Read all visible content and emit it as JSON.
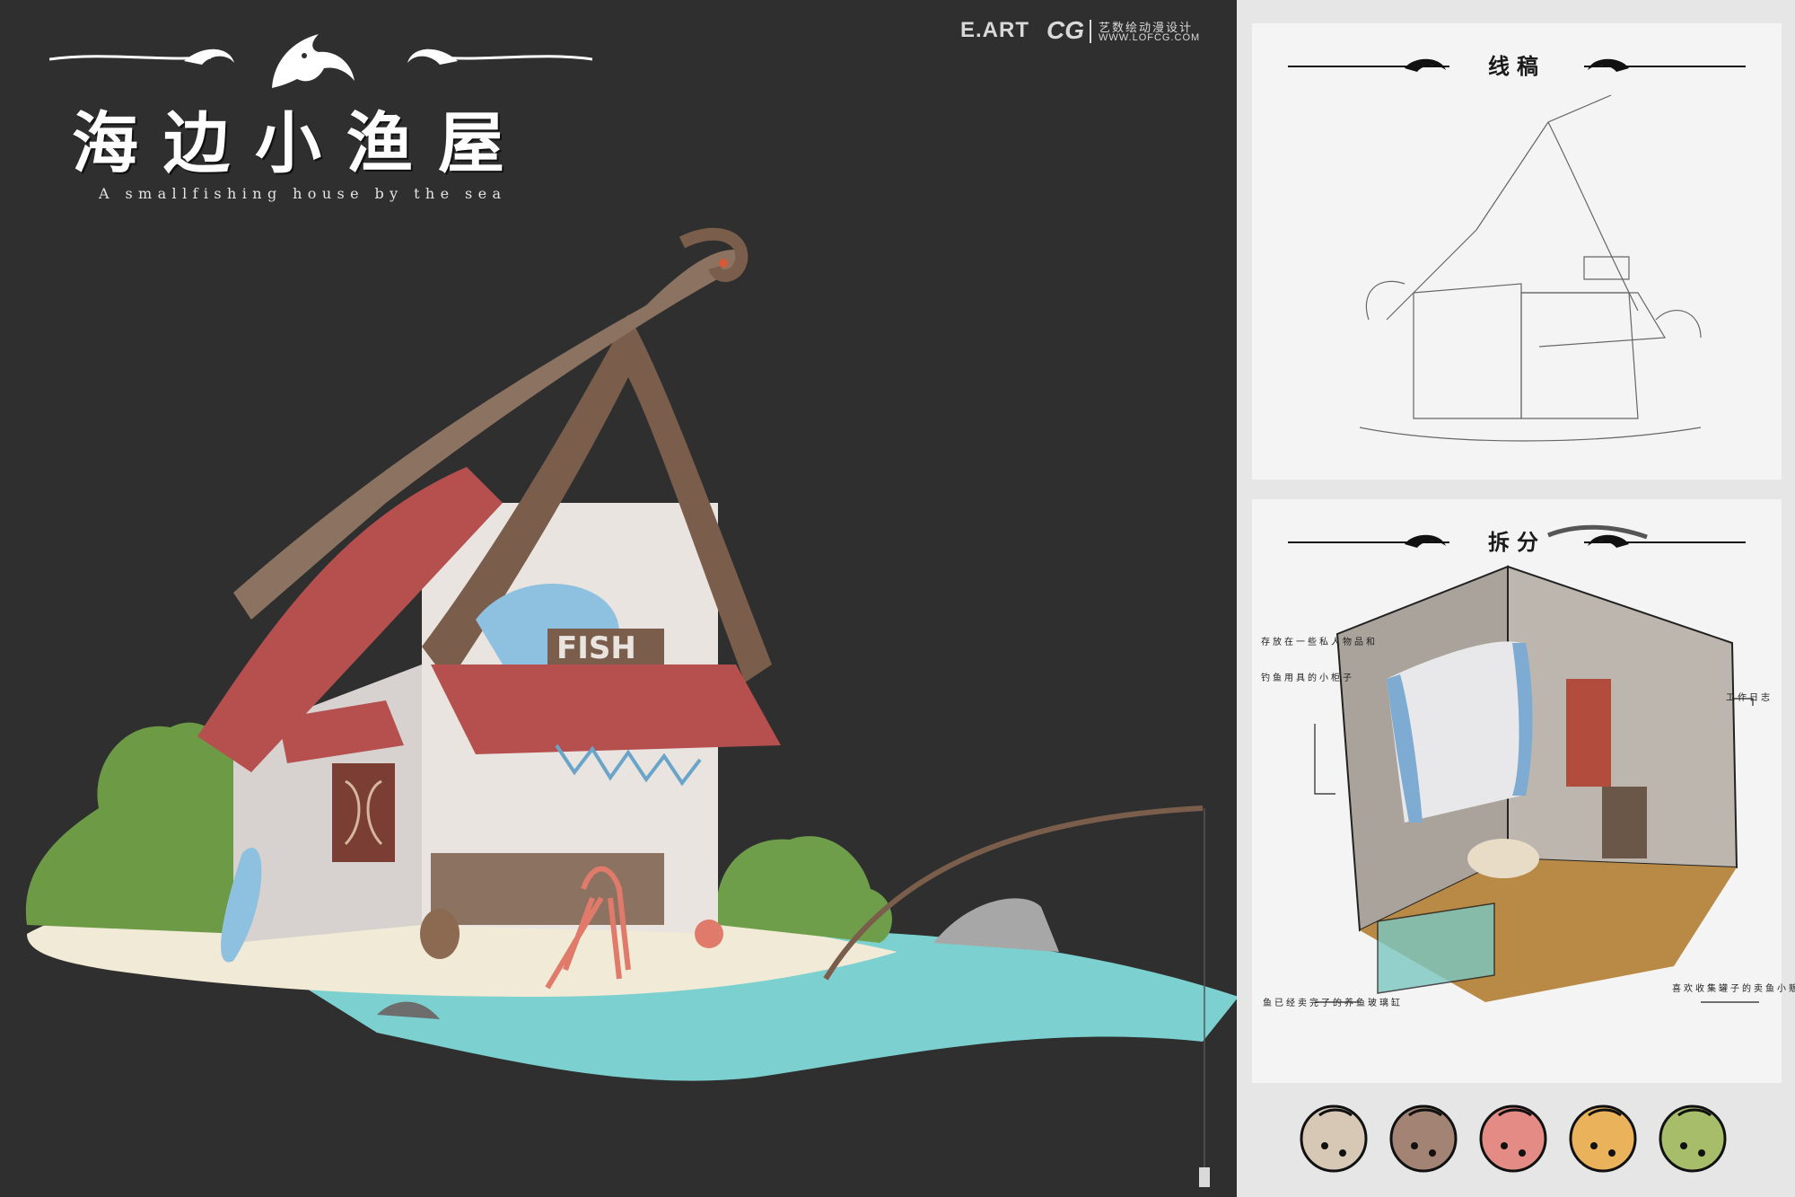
{
  "brand": {
    "logo_text": "E.ART",
    "logo_mark": "CG",
    "name_cn": "艺数绘动漫设计",
    "url": "WWW.LOFCG.COM"
  },
  "title": {
    "main": "海边小渔屋",
    "subtitle": "A smallfishing house by the sea"
  },
  "scene": {
    "sign_text": "FISH"
  },
  "panels": {
    "lineart_title": "线稿",
    "breakdown_title": "拆分",
    "annotations": {
      "cabinet_line1": "存放在一些私人物品和",
      "cabinet_line2": "钓鱼用具的小柜子",
      "work_log": "工作日志",
      "tank": "鱼已经卖完了的养鱼玻璃缸",
      "vendor": "喜欢收集罐子的卖鱼小贩"
    }
  },
  "palette": {
    "background_dark": "#2f2f2f",
    "roof_red": "#b6504f",
    "wood_brown": "#7a5e4b",
    "water_cyan": "#7cd0cf",
    "sand": "#f1ead6",
    "icon_colors": [
      "#d7c8b6",
      "#a38374",
      "#e38b84",
      "#eab25a",
      "#a7bd6a"
    ]
  },
  "icon_swatches": [
    {
      "name": "fish-icon-beige"
    },
    {
      "name": "fish-icon-brown"
    },
    {
      "name": "fish-icon-pink"
    },
    {
      "name": "fish-icon-orange"
    },
    {
      "name": "fish-icon-green"
    }
  ]
}
